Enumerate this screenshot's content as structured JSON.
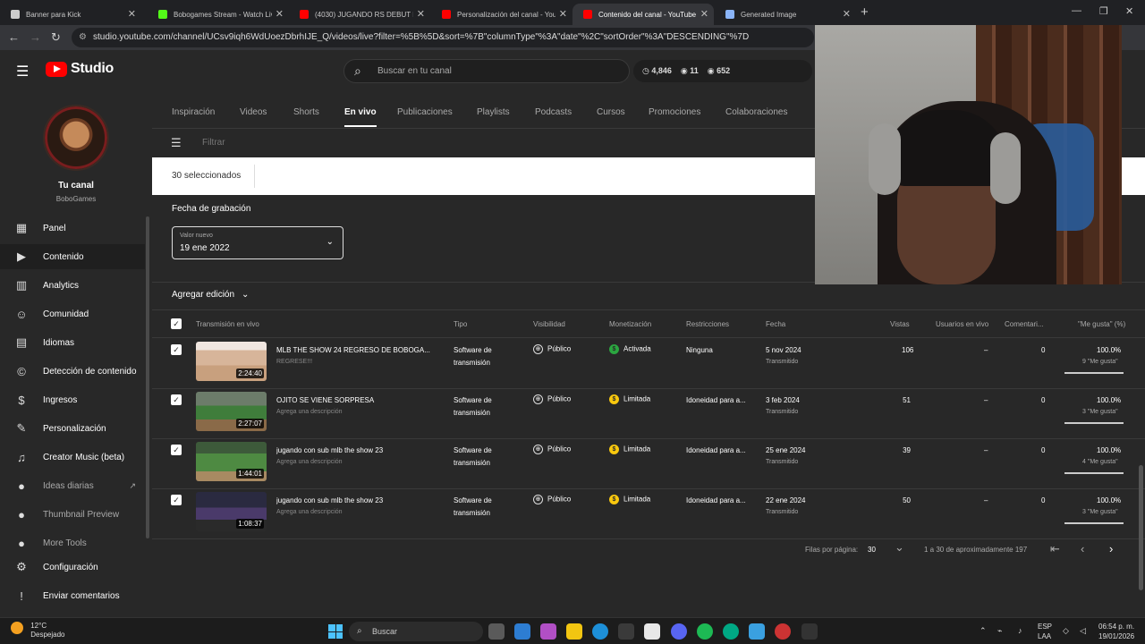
{
  "browser": {
    "tabs": [
      {
        "title": "Banner para Kick",
        "color": "#cccccc",
        "active": false
      },
      {
        "title": "Bobogames Stream - Watch Liv",
        "color": "#53fc18",
        "active": false
      },
      {
        "title": "(4030) JUGANDO RS DEBUT DE",
        "color": "#ff0000",
        "active": false
      },
      {
        "title": "Personalización del canal - You",
        "color": "#ff0000",
        "active": false
      },
      {
        "title": "Contenido del canal - YouTube",
        "color": "#ff0000",
        "active": true
      },
      {
        "title": "Generated Image",
        "color": "#8ab4f8",
        "active": false
      }
    ],
    "new_tab": "+",
    "url": "studio.youtube.com/channel/UCsv9iqh6WdUoezDbrhIJE_Q/videos/live?filter=%5B%5D&sort=%7B\"columnType\"%3A\"date\"%2C\"sortOrder\"%3A\"DESCENDING\"%7D"
  },
  "header": {
    "logo_text": "Studio",
    "search_placeholder": "Buscar en tu canal",
    "stats": [
      "4,846",
      "11",
      "652"
    ]
  },
  "sidebar": {
    "your_channel": "Tu canal",
    "channel_name": "BoboGames",
    "items": [
      {
        "label": "Panel",
        "icon": "dashboard-icon",
        "glyph": "▦"
      },
      {
        "label": "Contenido",
        "icon": "content-icon",
        "glyph": "▶"
      },
      {
        "label": "Analytics",
        "icon": "analytics-icon",
        "glyph": "▥"
      },
      {
        "label": "Comunidad",
        "icon": "community-icon",
        "glyph": "☺"
      },
      {
        "label": "Idiomas",
        "icon": "subtitles-icon",
        "glyph": "▤"
      },
      {
        "label": "Detección de contenido",
        "icon": "copyright-icon",
        "glyph": "©"
      },
      {
        "label": "Ingresos",
        "icon": "earn-icon",
        "glyph": "$"
      },
      {
        "label": "Personalización",
        "icon": "customization-icon",
        "glyph": "✎"
      },
      {
        "label": "Creator Music (beta)",
        "icon": "music-icon",
        "glyph": "♫"
      },
      {
        "label": "Ideas diarias",
        "icon": "ideas-icon",
        "glyph": "●"
      },
      {
        "label": "Thumbnail Preview",
        "icon": "thumbnail-icon",
        "glyph": "●"
      },
      {
        "label": "More Tools",
        "icon": "tools-icon",
        "glyph": "●"
      },
      {
        "label": "Configuración",
        "icon": "settings-icon",
        "glyph": "⚙"
      },
      {
        "label": "Enviar comentarios",
        "icon": "feedback-icon",
        "glyph": "!"
      }
    ]
  },
  "content_tabs": [
    "Inspiración",
    "Videos",
    "Shorts",
    "En vivo",
    "Publicaciones",
    "Playlists",
    "Podcasts",
    "Cursos",
    "Promociones",
    "Colaboraciones"
  ],
  "filter_placeholder": "Filtrar",
  "selection": {
    "count_label": "30 seleccionados"
  },
  "edit": {
    "field_label": "Fecha de grabación",
    "value_label": "Valor nuevo",
    "value": "19 ene 2022",
    "add_edit": "Agregar edición"
  },
  "table": {
    "headers": [
      "Transmisión en vivo",
      "Tipo",
      "Visibilidad",
      "Monetización",
      "Restricciones",
      "Fecha",
      "Vistas",
      "Usuarios en vivo",
      "Comentari...",
      "\"Me gusta\" (%)"
    ],
    "rows": [
      {
        "title": "MLB THE SHOW 24 REGRESO DE BOBOGA...",
        "desc": "REGRESE!!!",
        "duration": "2:24:40",
        "type1": "Software de",
        "type2": "transmisión",
        "visibility": "Público",
        "monetization": "Activada",
        "mon_color": "#2ba640",
        "restrictions": "Ninguna",
        "date": "5 nov 2024",
        "date_sub": "Transmitido",
        "views": "106",
        "live_users": "–",
        "comments": "0",
        "likes_pct": "100.0%",
        "likes_sub": "9 \"Me gusta\"",
        "thumb_bg": "linear-gradient(180deg,#f0e6e0 0 22%,#d7b59a 22% 60%,#c8a07e 60%)"
      },
      {
        "title": "OJITO SE VIENE SORPRESA",
        "desc": "Agrega una descripción",
        "duration": "2:27:07",
        "type1": "Software de",
        "type2": "transmisión",
        "visibility": "Público",
        "monetization": "Limitada",
        "mon_color": "#f9c80e",
        "restrictions": "Idoneidad para a...",
        "date": "3 feb 2024",
        "date_sub": "Transmitido",
        "views": "51",
        "live_users": "–",
        "comments": "0",
        "likes_pct": "100.0%",
        "likes_sub": "3 \"Me gusta\"",
        "thumb_bg": "linear-gradient(180deg,#6c7c6a 0 35%,#3f7d3b 35% 70%,#8a6a48 70%)"
      },
      {
        "title": "jugando con sub mlb the show 23",
        "desc": "Agrega una descripción",
        "duration": "1:44:01",
        "type1": "Software de",
        "type2": "transmisión",
        "visibility": "Público",
        "monetization": "Limitada",
        "mon_color": "#f9c80e",
        "restrictions": "Idoneidad para a...",
        "date": "25 ene 2024",
        "date_sub": "Transmitido",
        "views": "39",
        "live_users": "–",
        "comments": "0",
        "likes_pct": "100.0%",
        "likes_sub": "4 \"Me gusta\"",
        "thumb_bg": "linear-gradient(180deg,#3d5a3a 0 30%,#4e8a42 30% 75%,#a88a62 75%)"
      },
      {
        "title": "jugando con sub mlb the show 23",
        "desc": "Agrega una descripción",
        "duration": "1:08:37",
        "type1": "Software de",
        "type2": "transmisión",
        "visibility": "Público",
        "monetization": "Limitada",
        "mon_color": "#f9c80e",
        "restrictions": "Idoneidad para a...",
        "date": "22 ene 2024",
        "date_sub": "Transmitido",
        "views": "50",
        "live_users": "–",
        "comments": "0",
        "likes_pct": "100.0%",
        "likes_sub": "3 \"Me gusta\"",
        "thumb_bg": "linear-gradient(180deg,#2a2a40 0 40%,#4a3a6a 40% 70%,#2a2a2a 70%)"
      }
    ]
  },
  "pagination": {
    "rows_label": "Filas por página:",
    "rows_value": "30",
    "range": "1 a 30 de aproximadamente 197"
  },
  "taskbar": {
    "temp": "12°C",
    "weather": "Despejado",
    "search": "Buscar",
    "lang1": "ESP",
    "lang2": "LAA",
    "time": "06:54 p. m.",
    "date": "19/01/2026"
  }
}
